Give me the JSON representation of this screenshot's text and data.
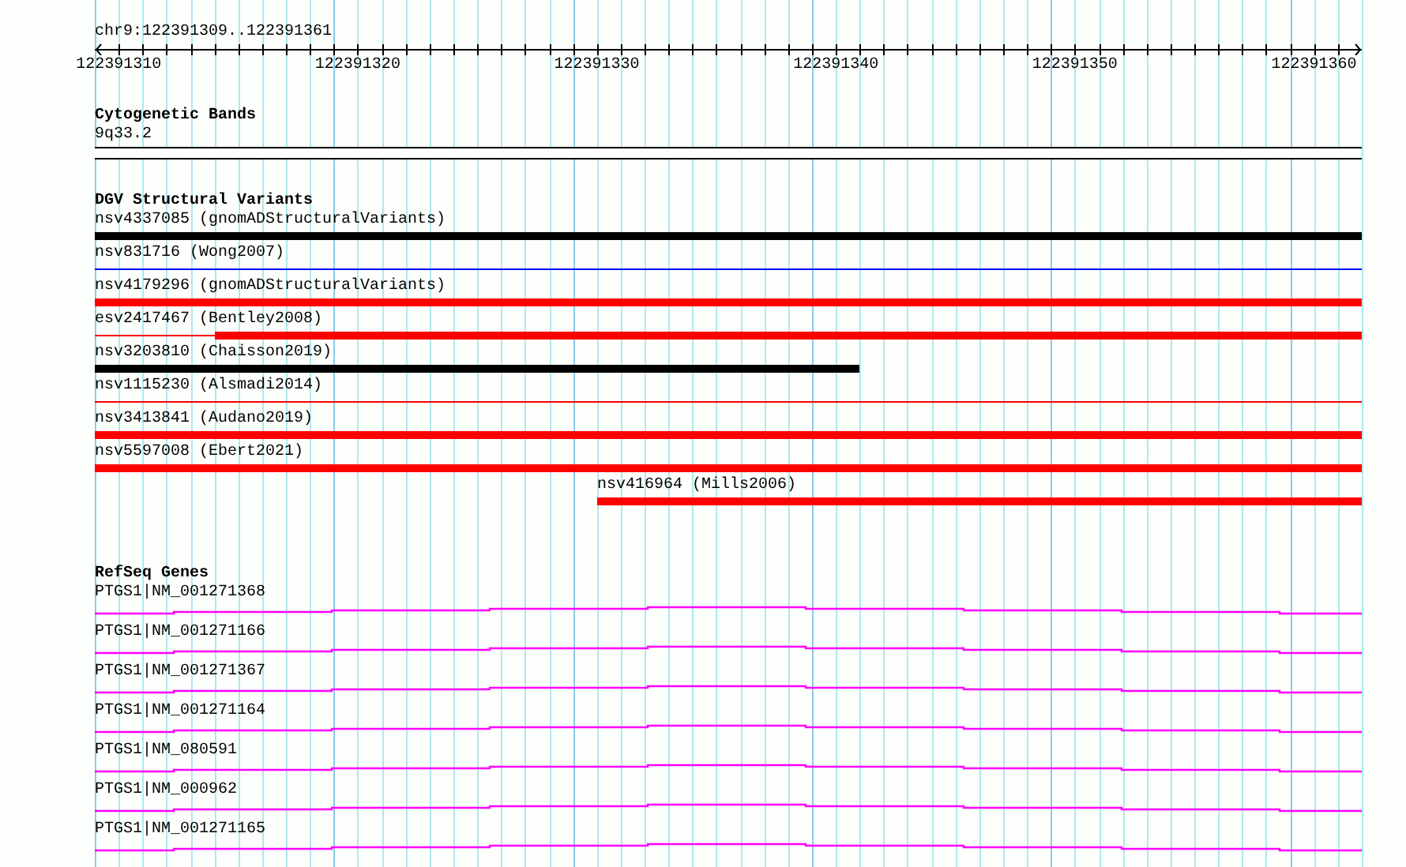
{
  "location": "chr9:122391309..122391361",
  "ruler": {
    "labels": [
      "122391310",
      "122391320",
      "122391330",
      "122391340",
      "122391350",
      "122391360"
    ]
  },
  "tracks": [
    {
      "kind": "bands",
      "title": "Cytogenetic Bands",
      "features": [
        {
          "label": "9q33.2"
        }
      ]
    },
    {
      "kind": "variants",
      "title": "DGV Structural Variants",
      "features": [
        {
          "label": "nsv4337085 (gnomADStructuralVariants)",
          "color": "#000000",
          "kind": "thick"
        },
        {
          "label": "nsv831716 (Wong2007)",
          "color": "#0000ff",
          "kind": "thin"
        },
        {
          "label": "nsv4179296 (gnomADStructuralVariants)",
          "color": "#ff0000",
          "kind": "thick"
        },
        {
          "label": "esv2417467 (Bentley2008)",
          "color": "#ff0000",
          "kind": "thin-thick"
        },
        {
          "label": "nsv3203810 (Chaisson2019)",
          "color": "#000000",
          "kind": "thick-left"
        },
        {
          "label": "nsv1115230 (Alsmadi2014)",
          "color": "#ff0000",
          "kind": "thin"
        },
        {
          "label": "nsv3413841 (Audano2019)",
          "color": "#ff0000",
          "kind": "thick"
        },
        {
          "label": "nsv5597008 (Ebert2021)",
          "color": "#ff0000",
          "kind": "thick"
        },
        {
          "label": "nsv416964 (Mills2006)",
          "color": "#ff0000",
          "kind": "thick-right"
        }
      ]
    },
    {
      "kind": "genes",
      "title": "RefSeq Genes",
      "features": [
        {
          "label": "PTGS1|NM_001271368"
        },
        {
          "label": "PTGS1|NM_001271166"
        },
        {
          "label": "PTGS1|NM_001271367"
        },
        {
          "label": "PTGS1|NM_001271164"
        },
        {
          "label": "PTGS1|NM_080591"
        },
        {
          "label": "PTGS1|NM_000962"
        },
        {
          "label": "PTGS1|NM_001271165"
        }
      ]
    }
  ]
}
